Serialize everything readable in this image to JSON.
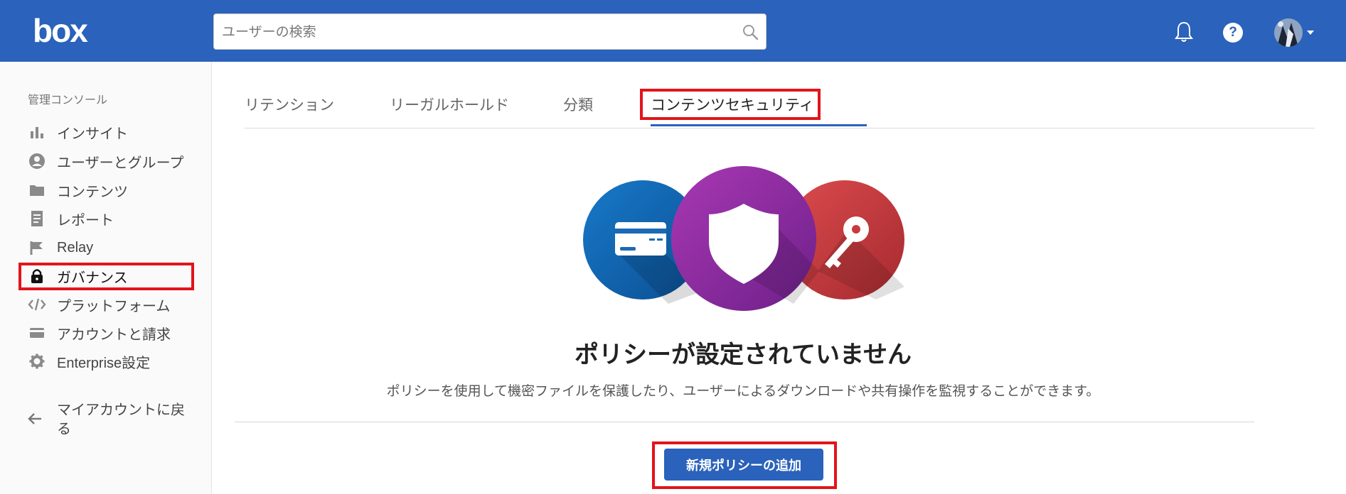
{
  "app": {
    "logo_text": "box",
    "brand_color": "#2a62bc",
    "highlight_color": "#e2141b"
  },
  "header": {
    "search_placeholder": "ユーザーの検索",
    "search_icon": "search-icon",
    "notifications_icon": "bell-icon",
    "help_label": "?",
    "avatar_icon": "user-avatar"
  },
  "sidebar": {
    "heading": "管理コンソール",
    "items": [
      {
        "label": "インサイト",
        "icon": "bar-chart-icon"
      },
      {
        "label": "ユーザーとグループ",
        "icon": "user-circle-icon"
      },
      {
        "label": "コンテンツ",
        "icon": "folder-icon"
      },
      {
        "label": "レポート",
        "icon": "report-icon"
      },
      {
        "label": "Relay",
        "icon": "relay-flag-icon"
      },
      {
        "label": "ガバナンス",
        "icon": "lock-icon",
        "active": true
      },
      {
        "label": "プラットフォーム",
        "icon": "code-icon"
      },
      {
        "label": "アカウントと請求",
        "icon": "credit-card-icon"
      },
      {
        "label": "Enterprise設定",
        "icon": "gear-icon"
      }
    ],
    "back_link": "マイアカウントに戻る"
  },
  "tabs": [
    {
      "label": "リテンション"
    },
    {
      "label": "リーガルホールド"
    },
    {
      "label": "分類"
    },
    {
      "label": "コンテンツセキュリティ",
      "active": true
    }
  ],
  "empty_state": {
    "title": "ポリシーが設定されていません",
    "description": "ポリシーを使用して機密ファイルを保護したり、ユーザーによるダウンロードや共有操作を監視することができます。",
    "icons": [
      "credit-card-circle-icon",
      "shield-circle-icon",
      "key-circle-icon"
    ]
  },
  "actions": {
    "add_policy_label": "新規ポリシーの追加"
  }
}
